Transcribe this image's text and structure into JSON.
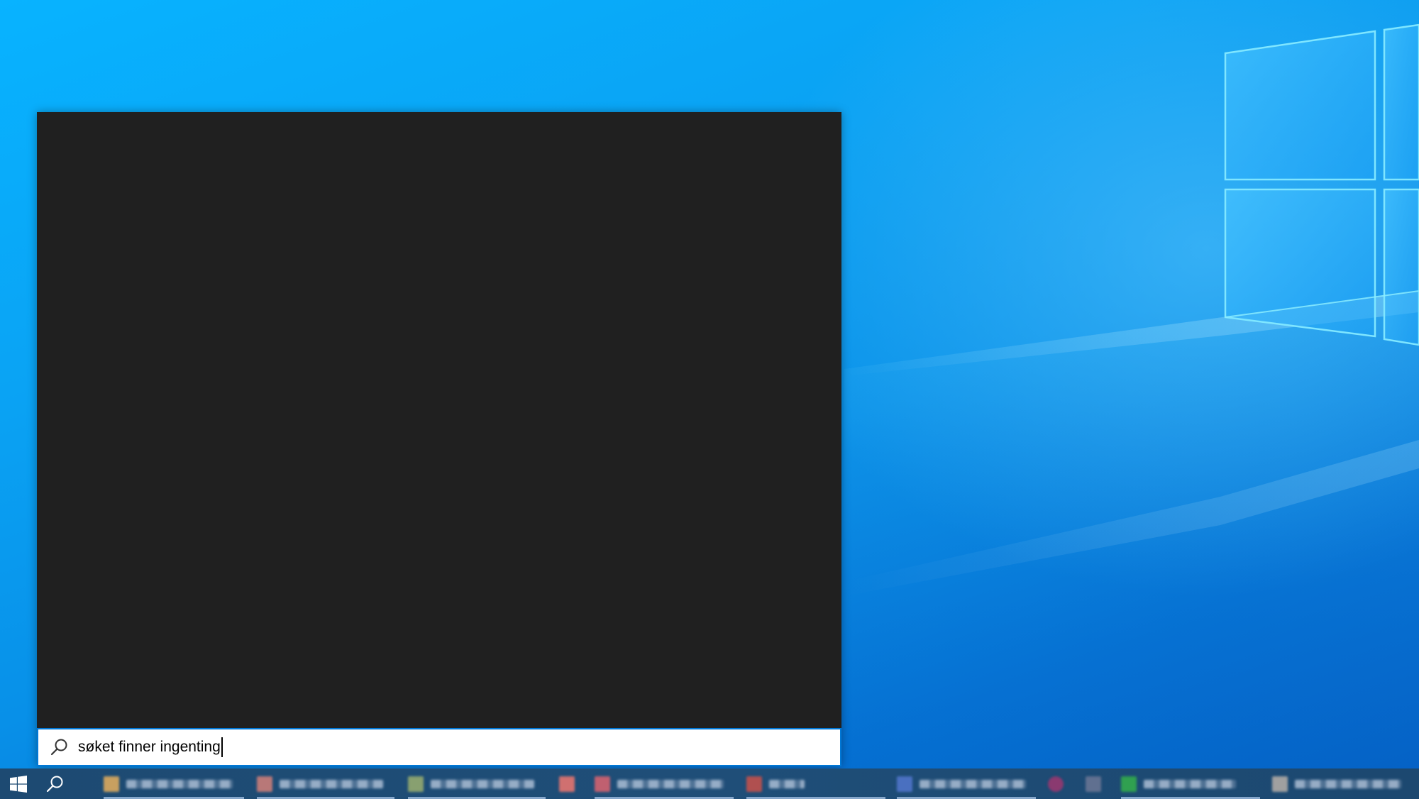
{
  "desktop": {
    "wallpaper": "windows-10-hero-light",
    "accent_color": "#0078d7",
    "background_color": "#0a9cf0"
  },
  "search_flyout": {
    "results_background": "#202020",
    "search_query": "søket finner ingenting",
    "search_icon": "search-icon"
  },
  "taskbar": {
    "background_color": "#1f4b73",
    "start_icon": "windows-logo-icon",
    "search_icon": "search-icon",
    "apps": [
      {
        "icon_color": "#c8a060",
        "blurred": true
      },
      {
        "icon_color": "#b87878",
        "blurred": true
      },
      {
        "icon_color": "#88a070",
        "blurred": true
      },
      {
        "icon_color": "#d07070",
        "blurred": true
      },
      {
        "icon_color": "#c06070",
        "blurred": true
      },
      {
        "icon_color": "#b05050",
        "blurred": true
      },
      {
        "icon_color": "#4a70c0",
        "blurred": true
      },
      {
        "icon_color": "#8a3a70",
        "blurred": true
      },
      {
        "icon_color": "#607090",
        "blurred": true
      },
      {
        "icon_color": "#30a050",
        "blurred": true
      },
      {
        "icon_color": "#a0a0a0",
        "blurred": true
      }
    ]
  }
}
